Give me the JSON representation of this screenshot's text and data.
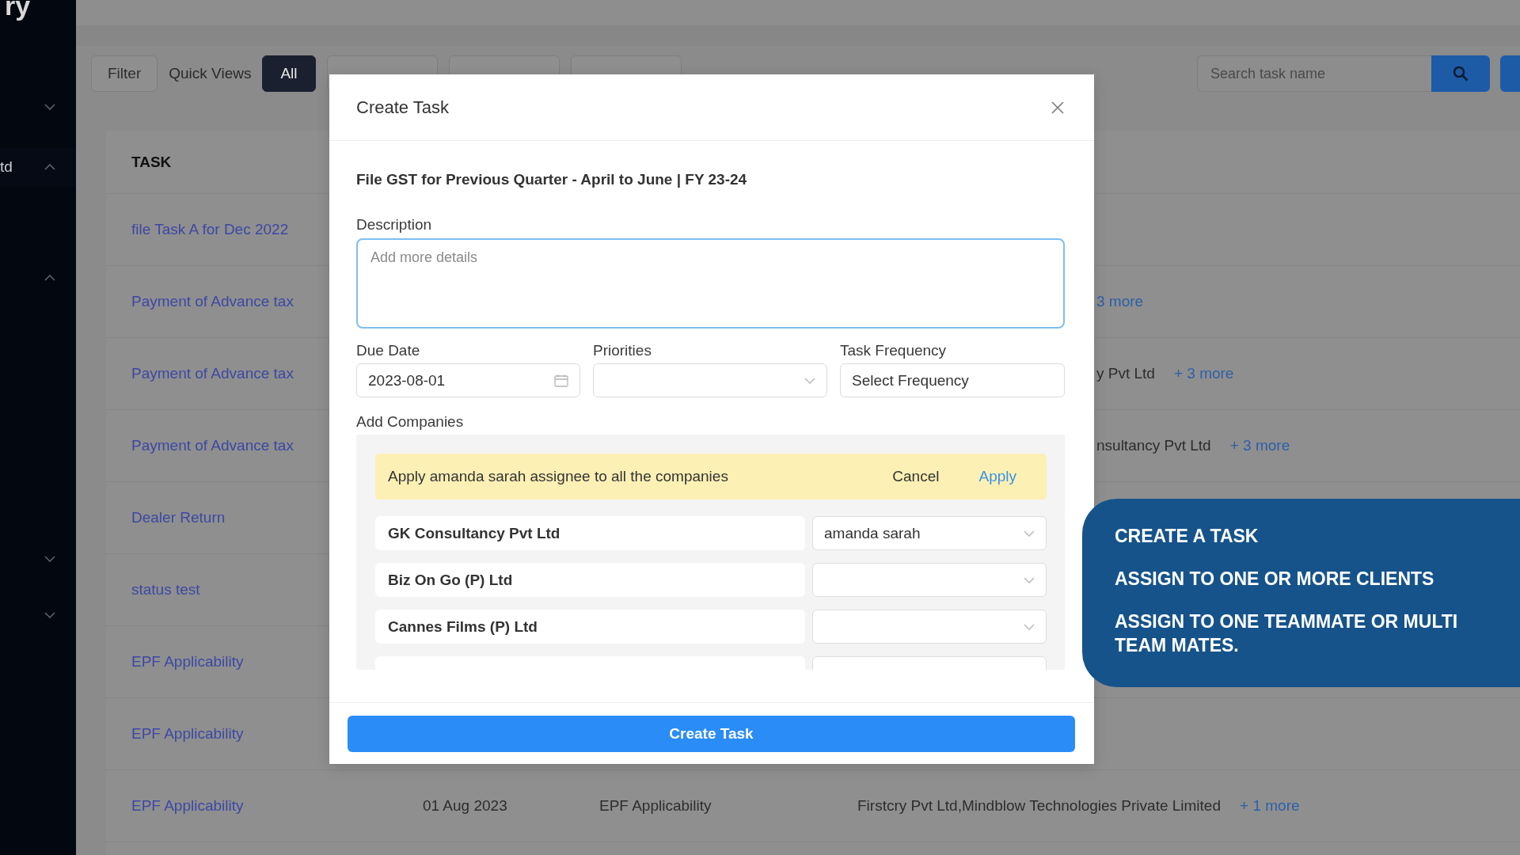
{
  "sidebar": {
    "logo": "ry",
    "items": [
      {
        "expanded": false
      },
      {
        "label": "td",
        "expanded": true
      },
      {
        "expanded": true
      },
      {
        "expanded": false
      },
      {
        "expanded": false
      }
    ]
  },
  "toolbar": {
    "filter": "Filter",
    "quick_views_label": "Quick Views",
    "views": [
      {
        "label": "All",
        "selected": true
      },
      {
        "selected": false
      },
      {
        "selected": false
      },
      {
        "selected": false
      }
    ],
    "search": {
      "placeholder": "Search task name"
    }
  },
  "table": {
    "header": "TASK",
    "rows": [
      {
        "task": "file Task A for Dec 2022"
      },
      {
        "task": "Payment of Advance tax",
        "more": "3 more"
      },
      {
        "task": "Payment of Advance tax",
        "companies": "y Pvt Ltd",
        "more": "+ 3 more"
      },
      {
        "task": "Payment of Advance tax",
        "companies": "nsultancy Pvt Ltd",
        "more": "+ 3 more"
      },
      {
        "task": "Dealer Return"
      },
      {
        "task": "status test"
      },
      {
        "task": "EPF Applicability"
      },
      {
        "task": "EPF Applicability"
      },
      {
        "task": "EPF Applicability",
        "due": "01 Aug 2023",
        "subject": "EPF Applicability",
        "companies": "Firstcry Pvt Ltd,Mindblow Technologies Private Limited",
        "more": "+ 1 more"
      }
    ]
  },
  "modal": {
    "title": "Create Task",
    "task_name": "File GST for Previous Quarter - April to June | FY 23-24",
    "description": {
      "label": "Description",
      "placeholder": "Add more details",
      "focused": true
    },
    "due_date": {
      "label": "Due Date",
      "value": "2023-08-01"
    },
    "priorities": {
      "label": "Priorities"
    },
    "task_frequency": {
      "label": "Task Frequency",
      "value": "Select Frequency"
    },
    "add_companies": {
      "label": "Add Companies",
      "banner": {
        "message": "Apply amanda sarah assignee to all the companies",
        "cancel": "Cancel",
        "apply": "Apply"
      },
      "companies": [
        {
          "name": "GK Consultancy Pvt Ltd",
          "assignee": "amanda sarah"
        },
        {
          "name": "Biz On Go (P) Ltd"
        },
        {
          "name": "Cannes Films (P) Ltd"
        }
      ],
      "more_below": true
    },
    "submit": "Create Task"
  },
  "callout": {
    "lines": [
      "CREATE A TASK",
      "ASSIGN TO ONE OR MORE CLIENTS",
      "ASSIGN TO ONE TEAMMATE OR MULTI TEAM MATES."
    ]
  }
}
